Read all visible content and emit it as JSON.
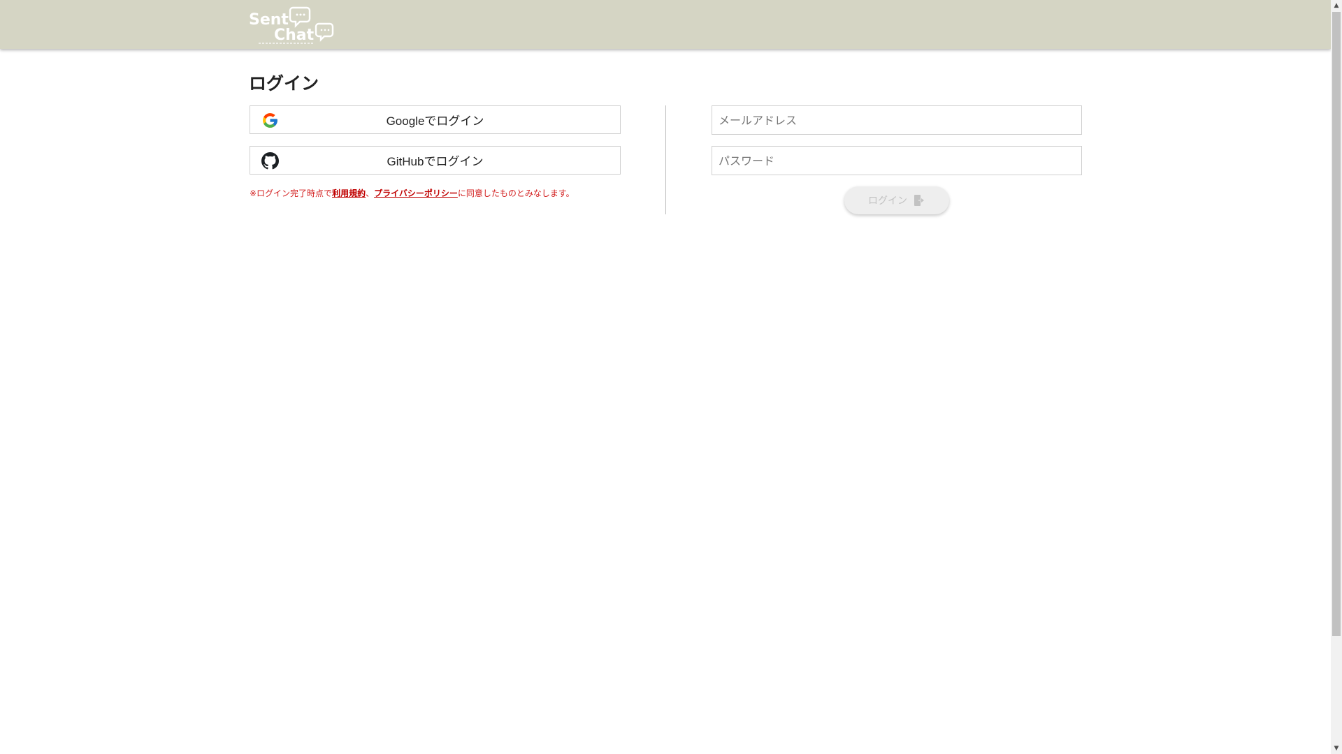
{
  "header": {
    "logo_text": "Sent Chat",
    "logo_line1": "Sent",
    "logo_line2": "Chat"
  },
  "page": {
    "title": "ログイン"
  },
  "social": {
    "google_label": "Googleでログイン",
    "github_label": "GitHubでログイン",
    "google_icon": "google-icon",
    "github_icon": "github-icon"
  },
  "notice": {
    "prefix": "※ログイン完了時点で",
    "terms_link": "利用規約",
    "separator": "、",
    "privacy_link": "プライバシーポリシー",
    "suffix": "に同意したものとみなします。"
  },
  "form": {
    "email_placeholder": "メールアドレス",
    "email_value": "",
    "password_placeholder": "パスワード",
    "password_value": "",
    "submit_label": "ログイン",
    "submit_icon": "login-door-icon"
  },
  "colors": {
    "header_bg": "#d5d5c4",
    "notice_red": "#d32020",
    "link_red": "#c00000",
    "disabled_button_bg": "#eeeeee",
    "disabled_button_text": "#c2c2c2"
  }
}
